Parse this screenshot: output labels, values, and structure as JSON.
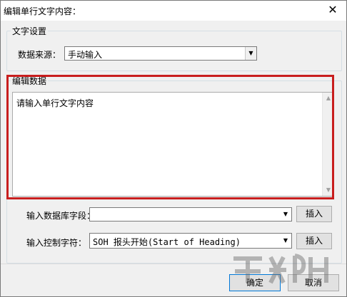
{
  "window": {
    "title": "编辑单行文字内容："
  },
  "text_settings": {
    "legend": "文字设置",
    "source_label": "数据来源：",
    "source_value": "手动输入"
  },
  "edit_data": {
    "legend": "编辑数据",
    "content": "请输入单行文字内容"
  },
  "db_field": {
    "label": "输入数据库字段：",
    "value": "",
    "insert_label": "插入"
  },
  "control_char": {
    "label": "输入控制字符：",
    "value": "SOH  报头开始(Start of Heading)",
    "insert_label": "插入"
  },
  "footer": {
    "ok_label": "确定",
    "cancel_label": "取消"
  },
  "colors": {
    "highlight": "#c81e1e",
    "button_focus": "#0078d7"
  }
}
